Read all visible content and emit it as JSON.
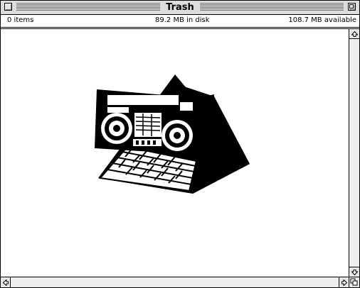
{
  "window": {
    "title": "Trash"
  },
  "info": {
    "items": "0 items",
    "disk": "89.2 MB in disk",
    "available": "108.7 MB available"
  },
  "icons": {
    "close_box": "close-box-icon",
    "zoom_box": "zoom-box-icon",
    "content_image": "boombox-pyramid-illustration",
    "scroll_up": "arrow-up-icon",
    "scroll_down": "arrow-down-icon",
    "scroll_left": "arrow-left-icon",
    "scroll_right": "arrow-right-icon",
    "grow_box": "resize-icon"
  },
  "colors": {
    "titlebar": "#dddddd",
    "scroll_track": "#eeeeee",
    "ink": "#000000"
  }
}
